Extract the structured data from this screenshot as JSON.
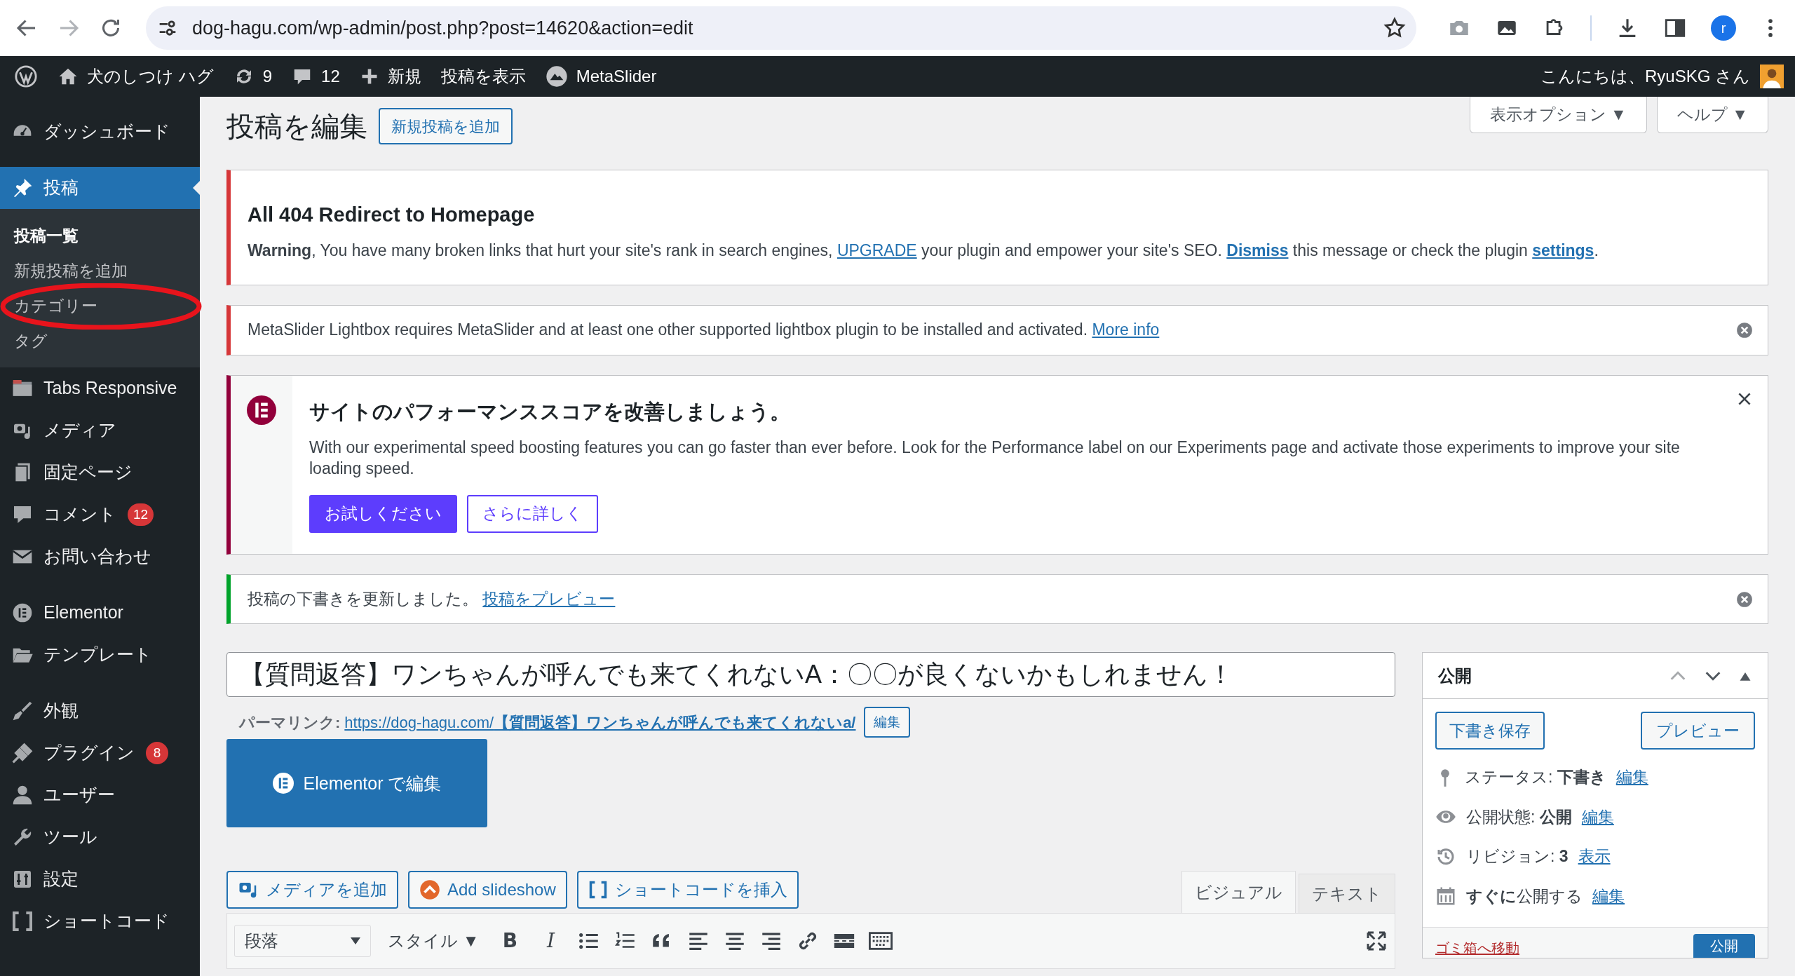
{
  "browser": {
    "url": "dog-hagu.com/wp-admin/post.php?post=14620&action=edit",
    "profile": "r"
  },
  "admin_bar": {
    "site": "犬のしつけ ハグ",
    "updates": "9",
    "comments": "12",
    "new": "新規",
    "view_post": "投稿を表示",
    "metaslider": "MetaSlider",
    "greeting": "こんにちは、RyuSKG さん"
  },
  "sidebar": {
    "groups": [
      [
        {
          "label": "ダッシュボード",
          "selected": false
        }
      ],
      [
        {
          "label": "投稿",
          "selected": true,
          "children": [
            {
              "label": "投稿一覧",
              "selected": true
            },
            {
              "label": "新規投稿を追加",
              "selected": false
            },
            {
              "label": "カテゴリー",
              "selected": false
            },
            {
              "label": "タグ",
              "selected": false
            }
          ]
        },
        {
          "label": "Tabs Responsive",
          "selected": false
        },
        {
          "label": "メディア",
          "selected": false
        },
        {
          "label": "固定ページ",
          "selected": false
        },
        {
          "label": "コメント",
          "selected": false,
          "badge": "12"
        },
        {
          "label": "お問い合わせ",
          "selected": false
        }
      ],
      [
        {
          "label": "Elementor",
          "selected": false
        },
        {
          "label": "テンプレート",
          "selected": false
        }
      ],
      [
        {
          "label": "外観",
          "selected": false
        },
        {
          "label": "プラグイン",
          "selected": false,
          "badge": "8"
        },
        {
          "label": "ユーザー",
          "selected": false
        },
        {
          "label": "ツール",
          "selected": false
        },
        {
          "label": "設定",
          "selected": false
        },
        {
          "label": "ショートコード",
          "selected": false
        }
      ]
    ]
  },
  "screen_tabs": [
    "表示オプション ▼",
    "ヘルプ ▼"
  ],
  "heading": "投稿を編集",
  "add_new": "新規投稿を追加",
  "notices": [
    {
      "kind": "error",
      "title": "All 404 Redirect to Homepage",
      "parts": [
        {
          "kind": "text",
          "text": "**Warning**, You have many broken links that hurt your site's rank in search engines, "
        },
        {
          "kind": "link",
          "text": "UPGRADE"
        },
        {
          "kind": "text",
          "text": " your plugin and empower your site's SEO.  "
        },
        {
          "kind": "strong_link",
          "text": "Dismiss"
        },
        {
          "kind": "text",
          "text": " this message or check the plugin "
        },
        {
          "kind": "strong_link",
          "text": "settings"
        },
        {
          "kind": "text",
          "text": "."
        }
      ],
      "dismissible": false
    },
    {
      "kind": "error",
      "parts": [
        {
          "kind": "text",
          "text": "MetaSlider Lightbox requires MetaSlider and at least one other supported lightbox plugin to be installed and activated. "
        },
        {
          "kind": "link",
          "text": "More info"
        }
      ],
      "dismissible": true
    },
    {
      "kind": "elementor",
      "title": "サイトのパフォーマンススコアを改善しましょう。",
      "parts": [
        {
          "kind": "text",
          "text": "With our experimental speed boosting features you can go faster than ever before. Look for the Performance label on our Experiments page and activate those experiments to improve your site loading speed."
        }
      ],
      "buttons": [
        "お試しください",
        "さらに詳しく"
      ],
      "dismissible": true
    },
    {
      "kind": "success",
      "parts": [
        {
          "kind": "text",
          "text": "投稿の下書きを更新しました。 "
        },
        {
          "kind": "link",
          "text": "投稿をプレビュー"
        }
      ],
      "dismissible": true
    }
  ],
  "post": {
    "title": "【質問返答】ワンちゃんが呼んでも来てくれないA：〇〇が良くないかもしれません！",
    "permalink_label": "パーマリンク:",
    "permalink_base": "https://dog-hagu.com/",
    "permalink_slug": "【質問返答】ワンちゃんが呼んでも来てくれないa/",
    "permalink_edit": "編集",
    "elementor_button": "Elementor で編集"
  },
  "media_buttons": [
    "メディアを追加",
    "Add slideshow",
    "ショートコードを挿入"
  ],
  "editor_tabs": [
    {
      "label": "ビジュアル",
      "selected": true
    },
    {
      "label": "テキスト",
      "selected": false
    }
  ],
  "toolbar": {
    "format": "段落",
    "styles": "スタイル ▼",
    "bold": "B",
    "italic": "I"
  },
  "publish": {
    "title": "公開",
    "save_draft": "下書き保存",
    "preview": "プレビュー",
    "rows": [
      {
        "text": "ステータス: **下書き**",
        "link": "編集"
      },
      {
        "text": "公開状態: **公開**",
        "link": "編集"
      },
      {
        "text": "リビジョン: **3**",
        "link": "表示"
      },
      {
        "text": "**すぐに**公開する",
        "link": "編集"
      }
    ],
    "trash": "ゴミ箱へ移動",
    "publish_button": "公開"
  }
}
